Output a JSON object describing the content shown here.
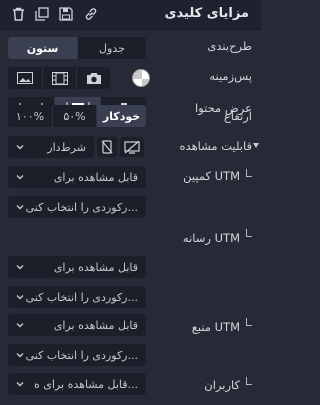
{
  "header": {
    "title": "مزایای کلیدی"
  },
  "layout_row": {
    "label": "طرح‌بندی",
    "options": [
      "جدول",
      "ستون"
    ],
    "selected": "ستون"
  },
  "background_row": {
    "label": "پس‌زمینه"
  },
  "content_width_row": {
    "label": "عرض محتوا"
  },
  "height_row": {
    "label": "ارتفاع",
    "options": [
      "خودکار",
      "۵۰%",
      "۱۰۰%"
    ],
    "selected": "خودکار"
  },
  "visibility_row": {
    "label": "قابلیت مشاهده",
    "select_value": "شرط‌دار"
  },
  "utm_fields": [
    {
      "label": "کمپین UTM",
      "visibility": "قابل مشاهده برای",
      "input_placeholder": "رکوردی را انتخاب کنی..."
    },
    {
      "label": "رسانه UTM",
      "visibility": "قابل مشاهده برای",
      "input_placeholder": "رکوردی را انتخاب کنی..."
    },
    {
      "label": "منبع UTM",
      "visibility": "قابل مشاهده برای",
      "input_placeholder": "رکوردی را انتخاب کنی..."
    },
    {
      "label": "کاربران",
      "visibility": "قابل مشاهده برای ه..."
    }
  ],
  "colors": {
    "panel_bg": "#262a36",
    "header_bg": "#1e2130",
    "control_bg": "#1c1f29",
    "active_bg": "#3a3f51"
  }
}
